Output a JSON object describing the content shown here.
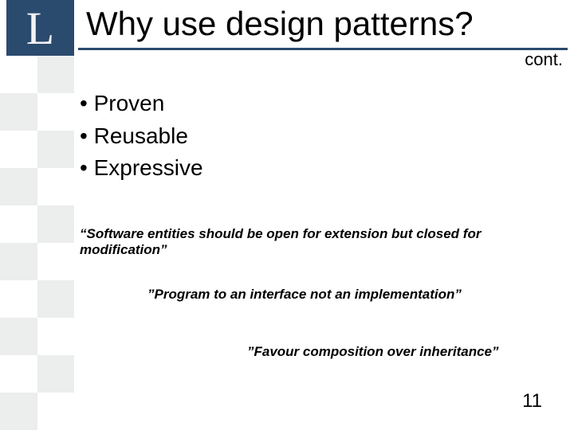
{
  "header": {
    "logo_letter": "L",
    "title": "Why use design patterns?",
    "cont": "cont."
  },
  "bullets": [
    "Proven",
    "Reusable",
    "Expressive"
  ],
  "quotes": {
    "q1": "“Software entities should be open for extension but closed for modification”",
    "q2": "”Program to an interface not an implementation”",
    "q3": "”Favour composition over inheritance”"
  },
  "page_number": "11"
}
